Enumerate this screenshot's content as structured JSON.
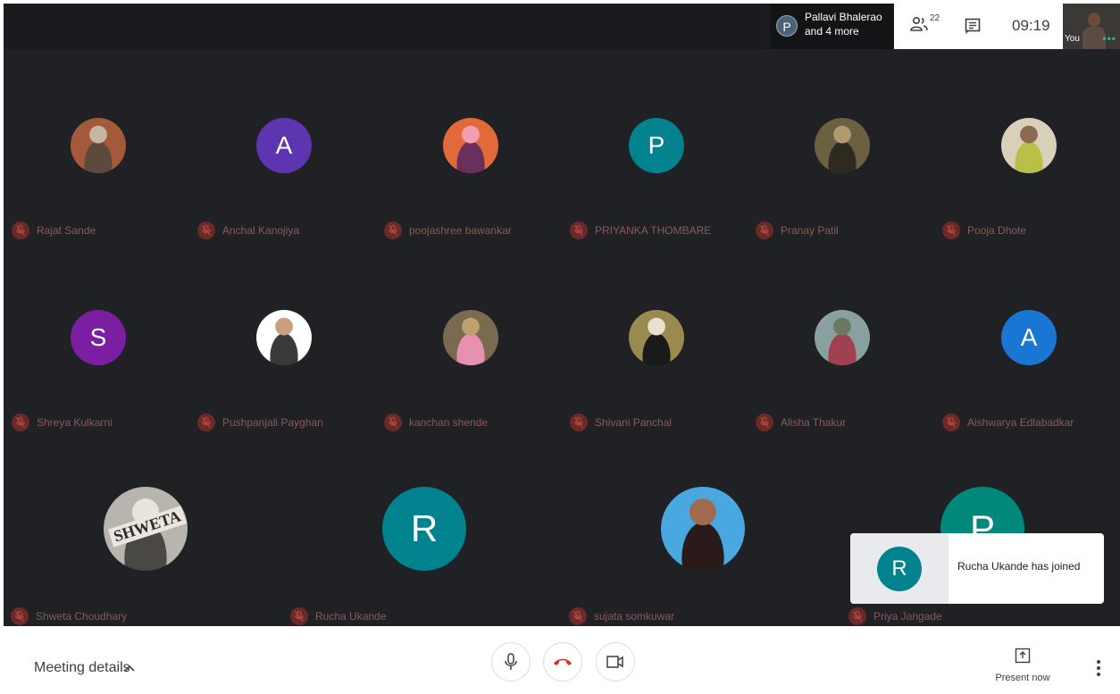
{
  "topbar": {
    "presenter_initial": "P",
    "presenter_name": "Pallavi Bhalerao",
    "presenter_more": "and 4 more",
    "participant_count": "22",
    "clock": "09:19",
    "self_label": "You"
  },
  "participants": [
    {
      "name": "Rajat Sande",
      "photo": true,
      "colors": [
        "#a45a3a",
        "#5d4a3d",
        "#c6b7a5"
      ]
    },
    {
      "name": "Anchal Kanojiya",
      "initial": "A",
      "color": "#5e35b1"
    },
    {
      "name": "poojashree bawankar",
      "photo": true,
      "colors": [
        "#e06a3a",
        "#6a2f5a",
        "#f0a0b0"
      ]
    },
    {
      "name": "PRIYANKA THOMBARE",
      "initial": "P",
      "color": "#00838f"
    },
    {
      "name": "Pranay Patil",
      "photo": true,
      "colors": [
        "#6b6040",
        "#2e2a22",
        "#b09a70"
      ]
    },
    {
      "name": "Pooja Dhote",
      "photo": true,
      "colors": [
        "#d8d0b8",
        "#b8c048",
        "#8a6a50"
      ]
    },
    {
      "name": "Shreya Kulkarni",
      "initial": "S",
      "color": "#7b1fa2"
    },
    {
      "name": "Pushpanjali Payghan",
      "photo": true,
      "colors": [
        "#ffffff",
        "#3a3a3a",
        "#c8a080"
      ]
    },
    {
      "name": "kanchan shende",
      "photo": true,
      "colors": [
        "#7a6a50",
        "#e890b0",
        "#c0a070"
      ]
    },
    {
      "name": "Shivani Panchal",
      "photo": true,
      "colors": [
        "#9a8a50",
        "#1a1a1a",
        "#e8e0d0"
      ]
    },
    {
      "name": "Alisha Thakur",
      "photo": true,
      "colors": [
        "#8aa0a0",
        "#a04050",
        "#6a7a60"
      ]
    },
    {
      "name": "Aishwarya Edlabadkar",
      "initial": "A",
      "color": "#1976d2"
    },
    {
      "name": "Shweta Choudhary",
      "photo": true,
      "text": "SHWETA",
      "colors": [
        "#b8b4ae",
        "#4a4844",
        "#e8e4dc"
      ]
    },
    {
      "name": "Rucha Ukande",
      "initial": "R",
      "color": "#00838f"
    },
    {
      "name": "sujata somkuwar",
      "photo": true,
      "colors": [
        "#4aa8e0",
        "#2a1a1a",
        "#a06a50"
      ]
    },
    {
      "name": "Priya Jangade",
      "initial": "P",
      "color": "#00897b"
    }
  ],
  "toast": {
    "initial": "R",
    "text": "Rucha Ukande has joined"
  },
  "bottombar": {
    "meeting_details": "Meeting details",
    "present_label": "Present now"
  },
  "colors": {
    "background": "#202124",
    "end_call": "#d93025",
    "muted_badge": "#6b2a27"
  }
}
